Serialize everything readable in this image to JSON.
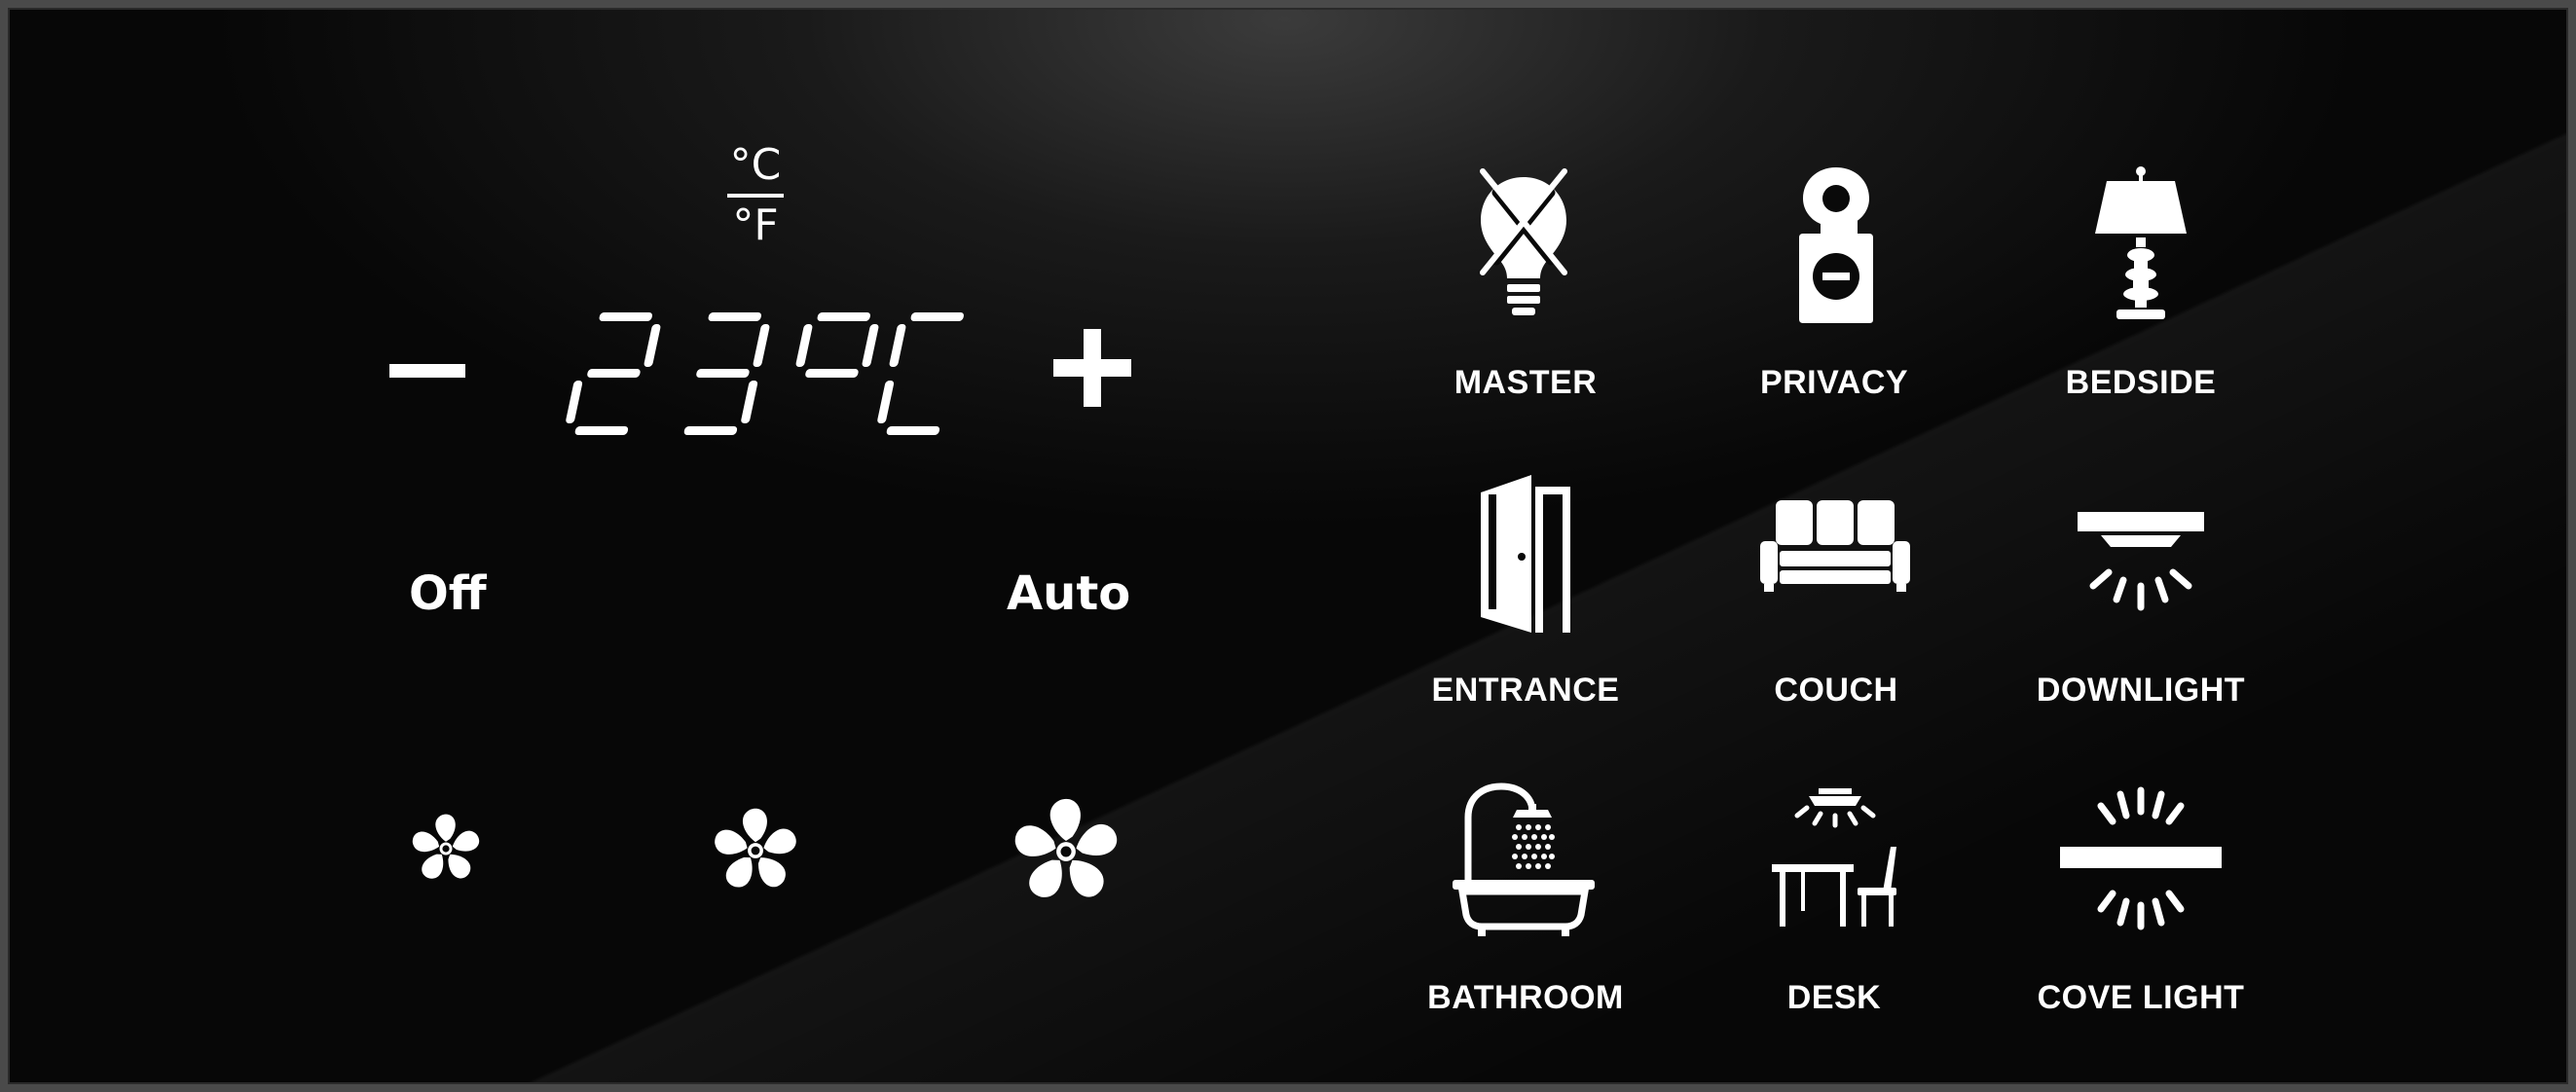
{
  "thermostat": {
    "unit_top": "°C",
    "unit_bottom": "°F",
    "temperature": "23",
    "temperature_unit": "°C",
    "minus_label": "−",
    "plus_label": "+",
    "mode_off": "Off",
    "mode_auto": "Auto",
    "fan_speeds": [
      "low",
      "medium",
      "high"
    ]
  },
  "scenes": [
    {
      "label": "MASTER",
      "icon": "master-off-bulb-icon"
    },
    {
      "label": "PRIVACY",
      "icon": "do-not-disturb-icon"
    },
    {
      "label": "BEDSIDE",
      "icon": "bedside-lamp-icon"
    },
    {
      "label": "ENTRANCE",
      "icon": "door-icon"
    },
    {
      "label": "COUCH",
      "icon": "couch-icon"
    },
    {
      "label": "DOWNLIGHT",
      "icon": "downlight-icon"
    },
    {
      "label": "BATHROOM",
      "icon": "bathtub-shower-icon"
    },
    {
      "label": "DESK",
      "icon": "desk-chair-icon"
    },
    {
      "label": "COVE LIGHT",
      "icon": "cove-light-icon"
    }
  ],
  "colors": {
    "panel_bg": "#070707",
    "foreground": "#ffffff"
  }
}
